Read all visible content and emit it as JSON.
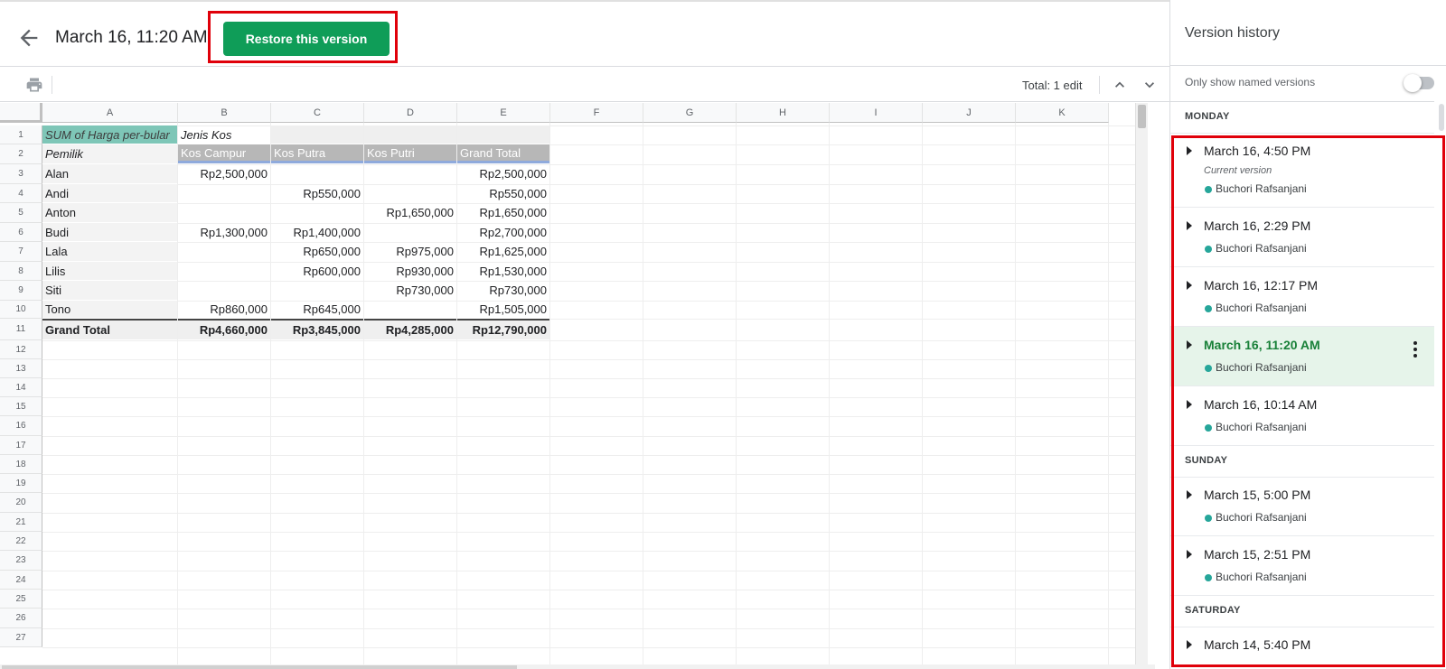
{
  "header": {
    "title": "March 16, 11:20 AM",
    "restore_label": "Restore this version"
  },
  "toolbar": {
    "total_edits": "Total: 1 edit"
  },
  "sheet": {
    "columns": [
      "A",
      "B",
      "C",
      "D",
      "E",
      "F",
      "G",
      "H",
      "I",
      "J",
      "K"
    ],
    "row_numbers": [
      "1",
      "2",
      "3",
      "4",
      "5",
      "6",
      "7",
      "8",
      "9",
      "10",
      "11",
      "12",
      "13",
      "14",
      "15",
      "16",
      "17",
      "18",
      "19",
      "20",
      "21",
      "22",
      "23",
      "24",
      "25",
      "26",
      "27"
    ],
    "pivot": {
      "corner_label": "SUM of Harga per-bular",
      "col_group_label": "Jenis Kos",
      "row_label": "Pemilik",
      "col_headers": [
        "Kos Campur",
        "Kos Putra",
        "Kos Putri",
        "Grand Total"
      ],
      "rows": [
        {
          "name": "Alan",
          "values": [
            "Rp2,500,000",
            "",
            "",
            "Rp2,500,000"
          ]
        },
        {
          "name": "Andi",
          "values": [
            "",
            "Rp550,000",
            "",
            "Rp550,000"
          ]
        },
        {
          "name": "Anton",
          "values": [
            "",
            "",
            "Rp1,650,000",
            "Rp1,650,000"
          ]
        },
        {
          "name": "Budi",
          "values": [
            "Rp1,300,000",
            "Rp1,400,000",
            "",
            "Rp2,700,000"
          ]
        },
        {
          "name": "Lala",
          "values": [
            "",
            "Rp650,000",
            "Rp975,000",
            "Rp1,625,000"
          ]
        },
        {
          "name": "Lilis",
          "values": [
            "",
            "Rp600,000",
            "Rp930,000",
            "Rp1,530,000"
          ]
        },
        {
          "name": "Siti",
          "values": [
            "",
            "",
            "Rp730,000",
            "Rp730,000"
          ]
        },
        {
          "name": "Tono",
          "values": [
            "Rp860,000",
            "Rp645,000",
            "",
            "Rp1,505,000"
          ]
        }
      ],
      "grand_total": {
        "name": "Grand Total",
        "values": [
          "Rp4,660,000",
          "Rp3,845,000",
          "Rp4,285,000",
          "Rp12,790,000"
        ]
      }
    }
  },
  "panel": {
    "title": "Version history",
    "named_only_label": "Only show named versions",
    "named_only_on": false,
    "groups": [
      {
        "day": "MONDAY",
        "versions": [
          {
            "time": "March 16, 4:50 PM",
            "note": "Current version",
            "user": "Buchori Rafsanjani",
            "selected": false
          },
          {
            "time": "March 16, 2:29 PM",
            "note": "",
            "user": "Buchori Rafsanjani",
            "selected": false
          },
          {
            "time": "March 16, 12:17 PM",
            "note": "",
            "user": "Buchori Rafsanjani",
            "selected": false
          },
          {
            "time": "March 16, 11:20 AM",
            "note": "",
            "user": "Buchori Rafsanjani",
            "selected": true
          },
          {
            "time": "March 16, 10:14 AM",
            "note": "",
            "user": "Buchori Rafsanjani",
            "selected": false
          }
        ]
      },
      {
        "day": "SUNDAY",
        "versions": [
          {
            "time": "March 15, 5:00 PM",
            "note": "",
            "user": "Buchori Rafsanjani",
            "selected": false
          },
          {
            "time": "March 15, 2:51 PM",
            "note": "",
            "user": "Buchori Rafsanjani",
            "selected": false
          }
        ]
      },
      {
        "day": "SATURDAY",
        "versions": [
          {
            "time": "March 14, 5:40 PM",
            "note": "",
            "user": "",
            "selected": false
          }
        ]
      }
    ]
  },
  "colors": {
    "restore_button": "#0f9d58",
    "highlight_frame": "#e0000a",
    "selected_row": "#e6f4ea",
    "selected_text": "#188038",
    "user_dot": "#26a69a",
    "pivot_corner": "#7ec6b7",
    "pivot_header": "#b7b7b7"
  },
  "icons": {
    "back": "arrow-left-icon",
    "print": "print-icon",
    "up": "chevron-up-icon",
    "down": "chevron-down-icon",
    "expand": "caret-right-icon",
    "more": "more-vert-icon"
  }
}
